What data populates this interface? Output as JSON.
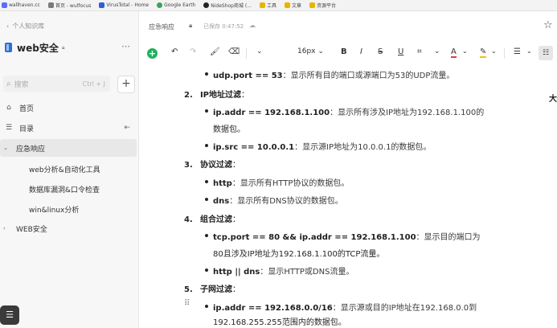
{
  "bookmarks": [
    {
      "label": "wallhaven.cc",
      "color": "#5b6cff"
    },
    {
      "label": "首页 - wulfocus",
      "color": "#7a7a7a"
    },
    {
      "label": "VirusTotal - Home",
      "color": "#2f5fd6"
    },
    {
      "label": "Google Earth",
      "color": "#3aa35b"
    },
    {
      "label": "NideShop商城 (...",
      "color": "#222222"
    },
    {
      "label": "工具",
      "color": "#e8b400"
    },
    {
      "label": "文章",
      "color": "#e8b400"
    },
    {
      "label": "资源平台",
      "color": "#e8b400"
    }
  ],
  "sidebar": {
    "breadcrumb": "个人知识库",
    "kb_title": "web安全",
    "search_placeholder": "搜索",
    "search_shortcut": "Ctrl + J",
    "nav": {
      "home": "首页",
      "catalog": "目录",
      "emergency": "应急响应"
    },
    "tree": [
      "web分析&自动化工具",
      "数据库漏洞&口令检查",
      "win&linux分析"
    ],
    "web_sec": "WEB安全"
  },
  "doc": {
    "title": "应急响应",
    "saved": "已保存 0:47:52"
  },
  "toolbar": {
    "font_size": "16px"
  },
  "content": {
    "l0_code": "udp.port == 53",
    "l0_desc": "：显示所有目的端口或源端口为53的UDP流量。",
    "s2_num": "2.",
    "s2_title": "IP地址过滤",
    "s2_colon": "：",
    "l1_code": "ip.addr == 192.168.1.100",
    "l1_desc": "：显示所有涉及IP地址为192.168.1.100的",
    "l1_desc2": "数据包。",
    "l2_code": "ip.src == 10.0.0.1",
    "l2_desc": "：显示源IP地址为10.0.0.1的数据包。",
    "s3_num": "3.",
    "s3_title": "协议过滤",
    "s3_colon": "：",
    "l3_code": "http",
    "l3_desc": "：显示所有HTTP协议的数据包。",
    "l4_code": "dns",
    "l4_desc": "：显示所有DNS协议的数据包。",
    "s4_num": "4.",
    "s4_title": "组合过滤",
    "s4_colon": "：",
    "l5_code": "tcp.port == 80 && ip.addr == 192.168.1.100",
    "l5_desc": "：显示目的端口为",
    "l5_desc2": "80且涉及IP地址为192.168.1.100的TCP流量。",
    "l6_code": "http || dns",
    "l6_desc": "：显示HTTP或DNS流量。",
    "s5_num": "5.",
    "s5_title": "子网过滤",
    "s5_colon": "：",
    "l7_code": "ip.addr == 192.168.0.0/16",
    "l7_desc": "：显示源或目的IP地址在192.168.0.0到",
    "l7_desc2": "192.168.255.255范围内的数据包。",
    "edge_char": "大"
  },
  "colors": {
    "accent_green": "#1eb15a",
    "kb_blue": "#2f6fd6",
    "font_color_red": "#e0403a",
    "highlight_yellow": "#f5c400"
  },
  "icons": {
    "lock": "lock-icon",
    "cloud": "cloud-icon",
    "star": "star-icon",
    "search": "search-icon",
    "add": "plus-icon",
    "home": "home-icon",
    "catalog": "list-icon"
  }
}
